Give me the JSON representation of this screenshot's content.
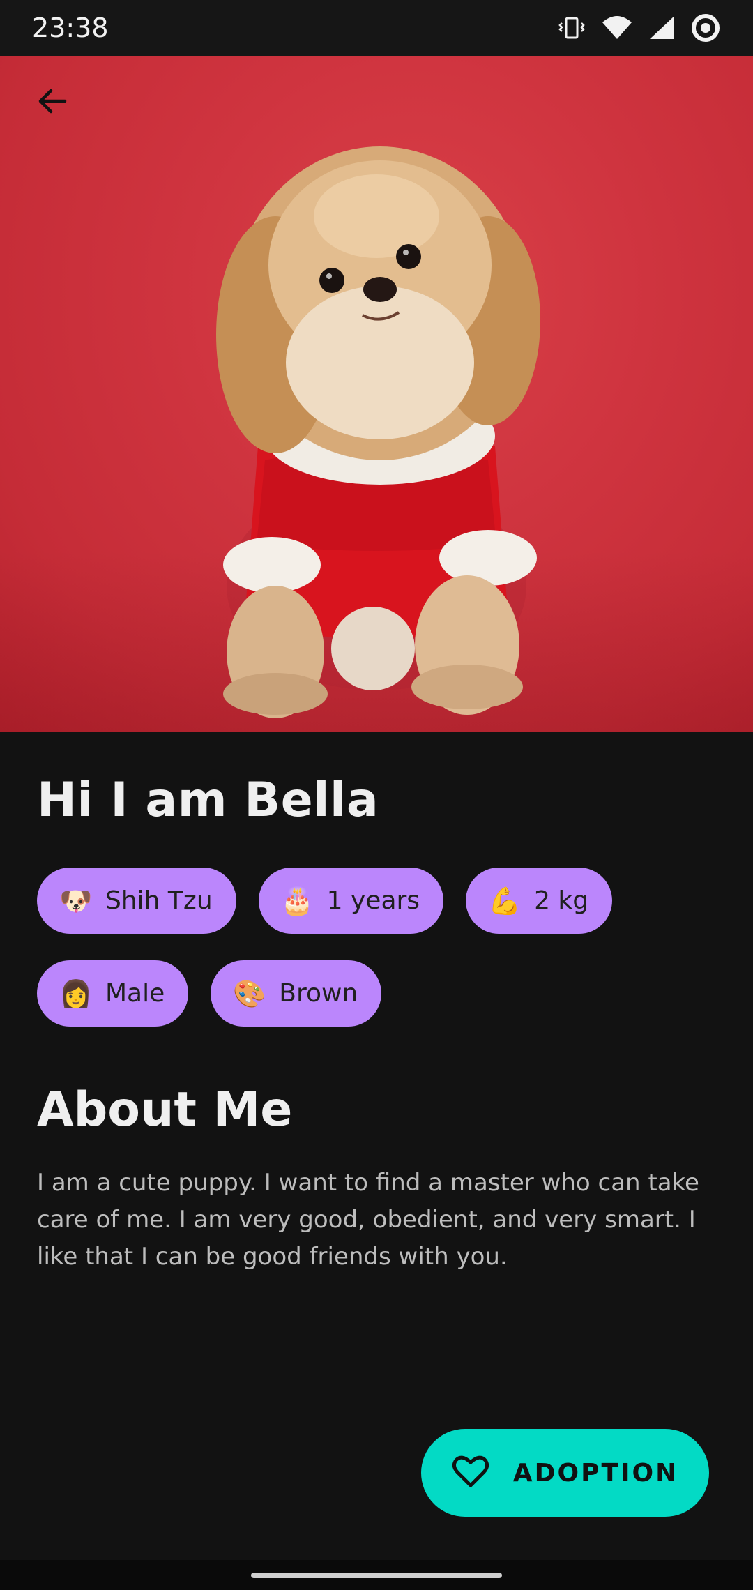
{
  "status_bar": {
    "time": "23:38",
    "icons": [
      "vibrate-icon",
      "wifi-icon",
      "signal-icon",
      "sync-circle-icon"
    ]
  },
  "hero": {
    "image": "shih-tzu-dog-in-red-sweater-photo",
    "back_icon": "arrow-left-icon",
    "background_color": "#cf343f"
  },
  "profile": {
    "title": "Hi I am Bella",
    "chips": [
      {
        "emoji": "🐶",
        "label": "Shih Tzu"
      },
      {
        "emoji": "🎂",
        "label": "1 years"
      },
      {
        "emoji": "💪",
        "label": "2 kg"
      },
      {
        "emoji": "👩",
        "label": "Male"
      },
      {
        "emoji": "🎨",
        "label": "Brown"
      }
    ]
  },
  "about": {
    "title": "About Me",
    "text": "I am a cute puppy. I want to find a master who can take care of me. I am very good, obedient, and very smart. I like that I can be good friends with you."
  },
  "fab": {
    "icon": "heart-outline-icon",
    "label": "ADOPTION",
    "color": "#03dac5"
  },
  "colors": {
    "chip_background": "#bb86fc",
    "background": "#121212"
  }
}
